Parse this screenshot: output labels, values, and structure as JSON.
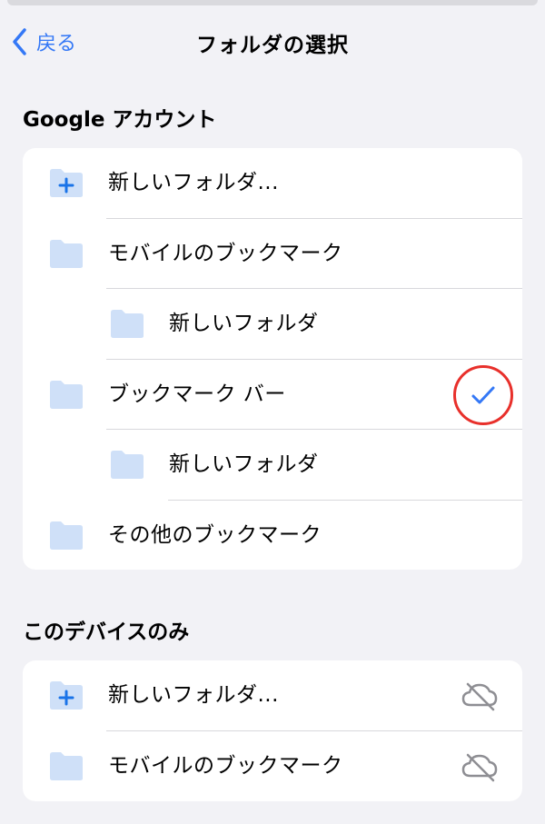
{
  "nav": {
    "back_label": "戻る",
    "title": "フォルダの選択"
  },
  "sections": {
    "google": {
      "header": "Google アカウント",
      "items": [
        {
          "label": "新しいフォルダ...",
          "icon": "folder-plus-icon"
        },
        {
          "label": "モバイルのブックマーク",
          "icon": "folder-icon"
        },
        {
          "label": "新しいフォルダ",
          "icon": "folder-icon"
        },
        {
          "label": "ブックマーク バー",
          "icon": "folder-icon",
          "selected": true
        },
        {
          "label": "新しいフォルダ",
          "icon": "folder-icon"
        },
        {
          "label": "その他のブックマーク",
          "icon": "folder-icon"
        }
      ]
    },
    "device": {
      "header": "このデバイスのみ",
      "items": [
        {
          "label": "新しいフォルダ...",
          "icon": "folder-plus-icon",
          "status_icon": "cloud-off-icon"
        },
        {
          "label": "モバイルのブックマーク",
          "icon": "folder-icon",
          "status_icon": "cloud-off-icon"
        }
      ]
    }
  },
  "colors": {
    "background": "#f2f2f6",
    "accent": "#3478f6",
    "folder": "#cfe0f8",
    "highlight_circle": "#e8302b"
  }
}
